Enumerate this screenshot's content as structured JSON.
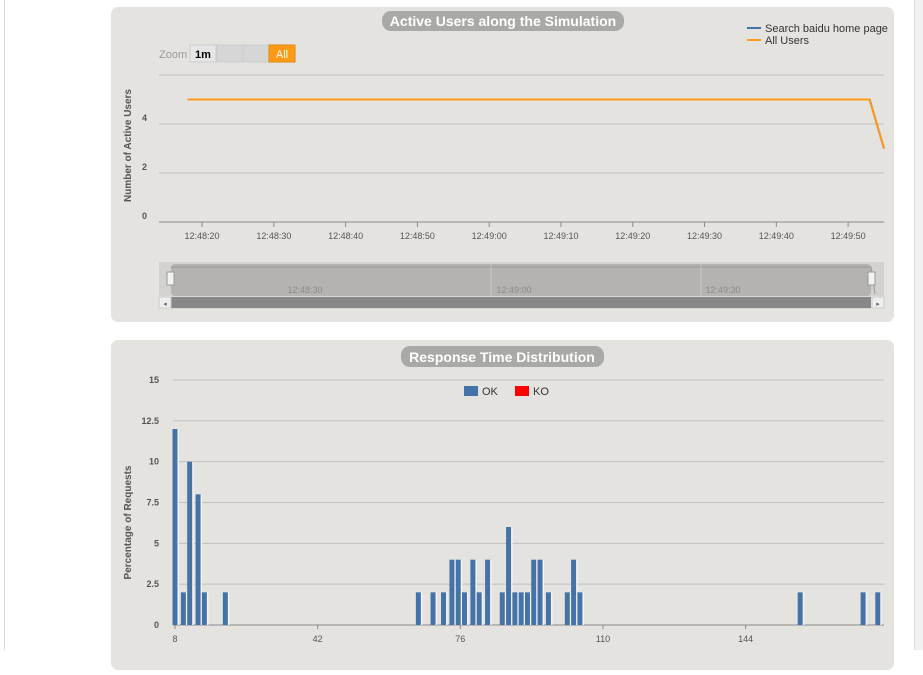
{
  "charts_meta": {
    "active_users": {
      "title": "Active Users along the Simulation",
      "zoom_label": "Zoom",
      "zoom_buttons": [
        "1m",
        "",
        "",
        "All"
      ],
      "navigator_labels": [
        "12:48:30",
        "12:49:00",
        "12:49:30"
      ]
    },
    "response_time": {
      "title": "Response Time Distribution"
    }
  },
  "colors": {
    "panel_bg": "#e5e3df",
    "title_bg": "#a9a9a5",
    "search_series": "#4572a7",
    "all_users_series": "#ff9916",
    "ok": "#4572a7",
    "ko": "#ff0000",
    "zoom_active": "#ff9916"
  },
  "chart_data": [
    {
      "type": "line",
      "title": "Active Users along the Simulation",
      "ylabel": "Number of Active Users",
      "xlabel": "",
      "ylim": [
        0,
        6
      ],
      "y_ticks": [
        "0",
        "2",
        "4"
      ],
      "x_ticks": [
        "12:48:20",
        "12:48:30",
        "12:48:40",
        "12:48:50",
        "12:49:00",
        "12:49:10",
        "12:49:20",
        "12:49:30",
        "12:49:40",
        "12:49:50"
      ],
      "x": [
        "12:48:18",
        "12:49:53",
        "12:49:55"
      ],
      "series": [
        {
          "name": "Search baidu home page",
          "values": [
            5,
            5,
            3
          ]
        },
        {
          "name": "All Users",
          "values": [
            5,
            5,
            3
          ]
        }
      ],
      "legend": "top-right",
      "grid": true
    },
    {
      "type": "bar",
      "title": "Response Time Distribution",
      "ylabel": "Percentage of Requests",
      "xlabel": "",
      "ylim": [
        0,
        15
      ],
      "y_ticks": [
        "0",
        "2.5",
        "5",
        "7.5",
        "10",
        "12.5",
        "15"
      ],
      "x_ticks": [
        "8",
        "42",
        "76",
        "110",
        "144"
      ],
      "x": [
        8,
        10,
        11.5,
        13.5,
        15,
        20,
        66,
        69.5,
        72,
        74,
        75.5,
        77,
        79,
        80.5,
        82.5,
        86,
        87.5,
        89,
        90.5,
        92,
        93.5,
        95,
        97,
        101.5,
        103,
        104.5,
        157,
        172,
        175.5
      ],
      "series": [
        {
          "name": "OK",
          "values": [
            12,
            2,
            10,
            8,
            2,
            2,
            2,
            2,
            2,
            4,
            4,
            2,
            4,
            2,
            4,
            2,
            6,
            2,
            2,
            2,
            4,
            4,
            2,
            2,
            4,
            2,
            2,
            2,
            2
          ]
        },
        {
          "name": "KO",
          "values": [
            0,
            0,
            0,
            0,
            0,
            0,
            0,
            0,
            0,
            0,
            0,
            0,
            0,
            0,
            0,
            0,
            0,
            0,
            0,
            0,
            0,
            0,
            0,
            0,
            0,
            0,
            0,
            0,
            0
          ]
        }
      ],
      "legend": "top-center",
      "grid": true
    }
  ]
}
